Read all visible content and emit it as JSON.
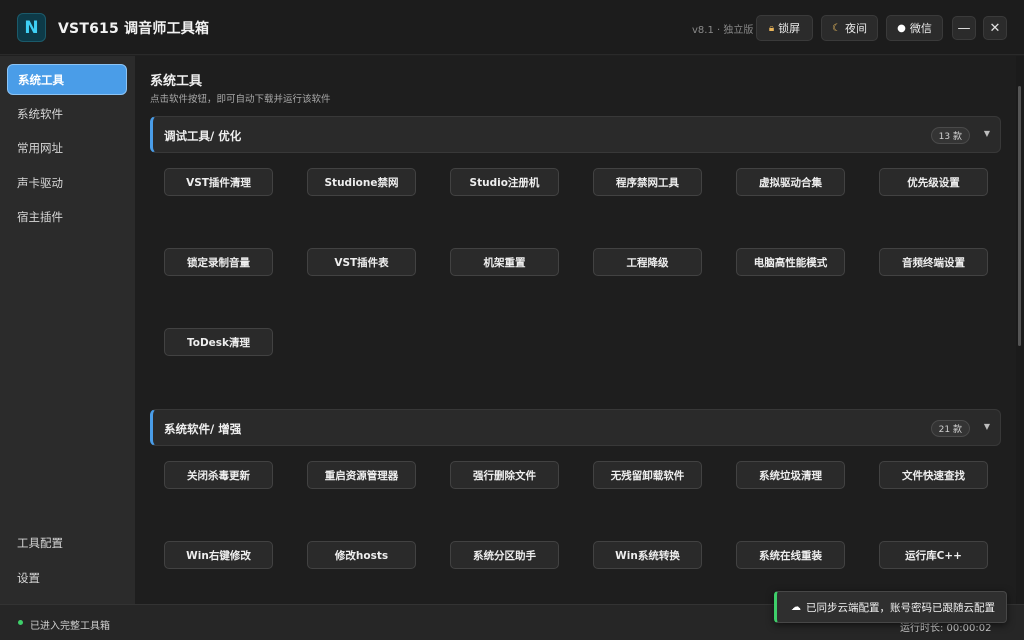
{
  "app": {
    "logo_letter": "N",
    "title": "VST615 调音师工具箱",
    "version": "v8.1 · 独立版"
  },
  "toolbar": {
    "lock_label": "锁屏",
    "night_label": "夜间",
    "wechat_label": "微信",
    "minimize_label": "—",
    "close_label": "✕"
  },
  "sidebar": {
    "items": [
      {
        "label": "系统工具",
        "active": true
      },
      {
        "label": "系统软件",
        "active": false
      },
      {
        "label": "常用网址",
        "active": false
      },
      {
        "label": "声卡驱动",
        "active": false
      },
      {
        "label": "宿主插件",
        "active": false
      }
    ],
    "bottom_items": [
      {
        "label": "工具配置"
      },
      {
        "label": "设置"
      }
    ]
  },
  "main": {
    "title": "系统工具",
    "subtitle": "点击软件按钮，即可自动下载并运行该软件",
    "sections": [
      {
        "title": "调试工具/ 优化",
        "count": "13 款",
        "tools": [
          "VST插件清理",
          "Studione禁网",
          "Studio注册机",
          "程序禁网工具",
          "虚拟驱动合集",
          "优先级设置",
          "锁定录制音量",
          "VST插件表",
          "机架重置",
          "工程降级",
          "电脑高性能模式",
          "音频终端设置",
          "ToDesk清理"
        ]
      },
      {
        "title": "系统软件/ 增强",
        "count": "21 款",
        "tools": [
          "关闭杀毒更新",
          "重启资源管理器",
          "强行删除文件",
          "无残留卸载软件",
          "系统垃圾清理",
          "文件快速查找",
          "Win右键修改",
          "修改hosts",
          "系统分区助手",
          "Win系统转换",
          "系统在线重装",
          "运行库C++"
        ]
      }
    ]
  },
  "status": {
    "text": "已进入完整工具箱",
    "runtime": "运行时长: 00:00:02"
  },
  "toast": {
    "text": "已同步云端配置，账号密码已跟随云配置"
  },
  "colors": {
    "accent": "#4a9de8",
    "success": "#3ecf6a",
    "logo": "#3fd0f5"
  }
}
